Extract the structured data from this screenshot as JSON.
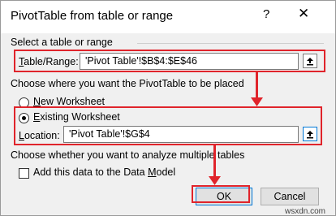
{
  "dialog": {
    "title": "PivotTable from table or range",
    "help_label": "?",
    "close_label": "✕"
  },
  "source": {
    "section_label": "Select a table or range",
    "range_label_first": "T",
    "range_label_rest": "able/Range:",
    "range_value": "'Pivot Table'!$B$4:$E$46"
  },
  "placement": {
    "section_label": "Choose where you want the PivotTable to be placed",
    "new_ws_first": "N",
    "new_ws_rest": "ew Worksheet",
    "existing_ws_first": "E",
    "existing_ws_rest": "xisting Worksheet",
    "selected": "existing",
    "location_label_first": "L",
    "location_label_rest": "ocation:",
    "location_value": "'Pivot Table'!$G$4"
  },
  "multi": {
    "section_label": "Choose whether you want to analyze multiple tables",
    "data_model_prefix": "Add this data to the Data ",
    "data_model_key": "M",
    "data_model_rest": "odel",
    "checked": false
  },
  "buttons": {
    "ok_label": "OK",
    "cancel_label": "Cancel"
  },
  "watermark": "wsxdn.com",
  "colors": {
    "highlight": "#e0242b",
    "accent": "#0078d7"
  }
}
